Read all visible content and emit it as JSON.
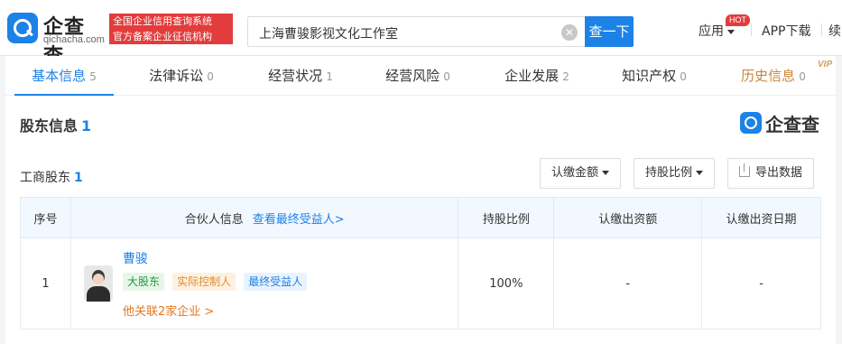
{
  "header": {
    "logo_text": "企查查",
    "logo_sub": "qichacha.com",
    "slogan_line1": "全国企业信用查询系统",
    "slogan_line2": "官方备案企业征信机构",
    "search_value": "上海曹骏影视文化工作室",
    "search_button": "查一下",
    "nav_app": "应用",
    "hot_badge": "HOT",
    "nav_app_download": "APP下载",
    "nav_more": "续"
  },
  "tabs": [
    {
      "label": "基本信息",
      "count": "5"
    },
    {
      "label": "法律诉讼",
      "count": "0"
    },
    {
      "label": "经营状况",
      "count": "1"
    },
    {
      "label": "经营风险",
      "count": "0"
    },
    {
      "label": "企业发展",
      "count": "2"
    },
    {
      "label": "知识产权",
      "count": "0"
    },
    {
      "label": "历史信息",
      "count": "0"
    }
  ],
  "vip_label": "VIP",
  "section": {
    "title": "股东信息",
    "count": "1",
    "brand_text": "企查查",
    "sub_title": "工商股东",
    "sub_count": "1",
    "btn_subscribed_amount": "认缴金额",
    "btn_share_ratio": "持股比例",
    "btn_export": "导出数据"
  },
  "table": {
    "headers": {
      "index": "序号",
      "partner": "合伙人信息",
      "partner_link": "查看最终受益人>",
      "ratio": "持股比例",
      "amount": "认缴出资额",
      "date": "认缴出资日期"
    },
    "rows": [
      {
        "index": "1",
        "name": "曹骏",
        "tags": [
          "大股东",
          "实际控制人",
          "最终受益人"
        ],
        "related": "他关联2家企业  >",
        "ratio": "100%",
        "amount": "-",
        "date": "-"
      }
    ]
  },
  "colors": {
    "brand_blue": "#1d82e6",
    "slogan_red": "#e23c3c",
    "history_gold": "#c8873a",
    "related_orange": "#e4781f"
  }
}
